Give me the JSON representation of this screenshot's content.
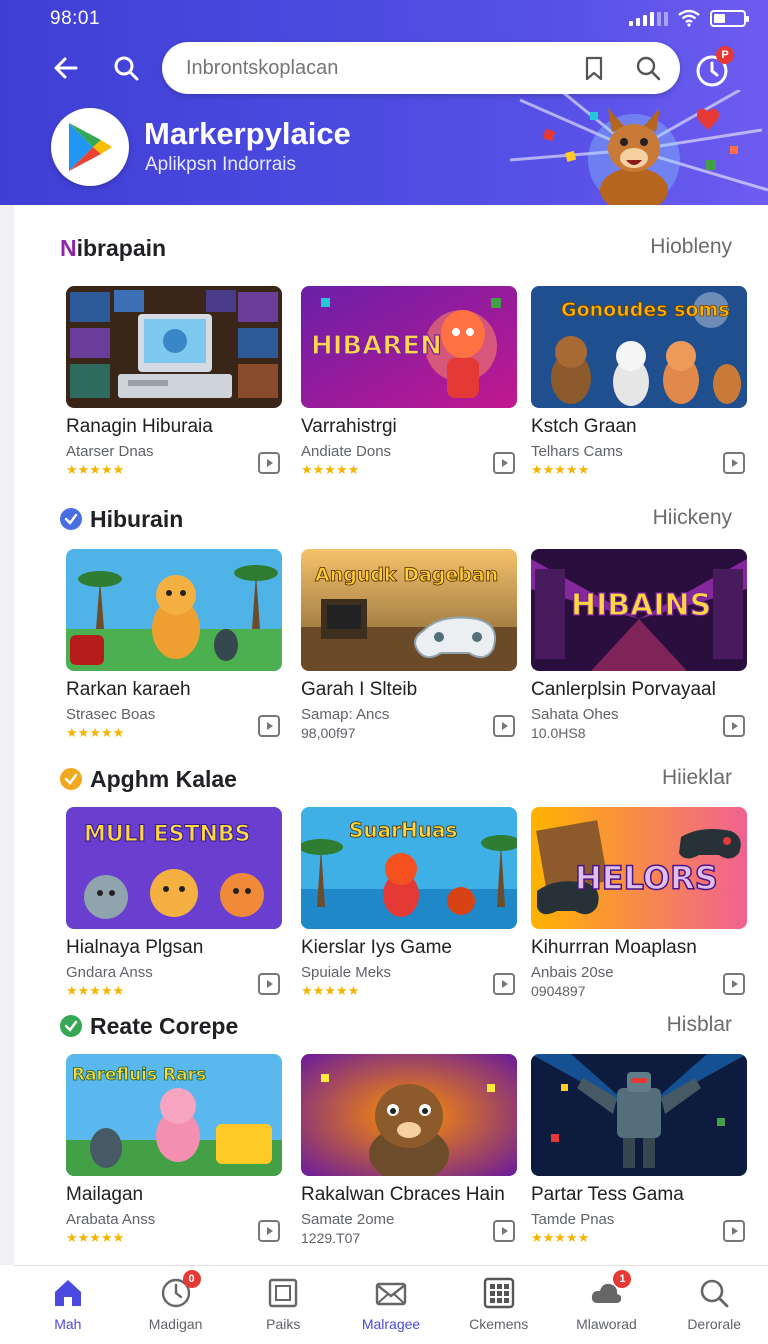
{
  "status_bar": {
    "time": "98:01"
  },
  "header": {
    "search_placeholder": "Inbrontskoplacan",
    "profile_badge": "P",
    "brand_title": "Markerpylaice",
    "brand_subtitle": "Aplikpsn Indorrais"
  },
  "sections": [
    {
      "title": "Nibrapain",
      "more": "Hiobleny",
      "icon": "none",
      "cards": [
        {
          "title": "Ranagin Hiburaia",
          "sub": "Atarser Dnas",
          "stars": "★★★★★"
        },
        {
          "title": "Varrahistrgi",
          "sub": "Andiate Dons",
          "stars": "★★★★★"
        },
        {
          "title": "Kstch Graan",
          "sub": "Telhars Cams",
          "stars": "★★★★★"
        }
      ]
    },
    {
      "title": "Hiburain",
      "more": "Hiickeny",
      "icon": "check-blue",
      "cards": [
        {
          "title": "Rarkan karaeh",
          "sub": "Strasec Boas",
          "stars": "★★★★★"
        },
        {
          "title": "Garah I Slteib",
          "sub": "Samap: Ancs",
          "meta": "98,00f97"
        },
        {
          "title": "Canlerplsin Porvayaal",
          "sub": "Sahata Ohes",
          "meta": "10.0HS8"
        }
      ]
    },
    {
      "title": "Apghm Kalae",
      "more": "Hiieklar",
      "icon": "check-orange",
      "cards": [
        {
          "title": "Hialnaya Plgsan",
          "sub": "Gndara Anss",
          "stars": "★★★★★"
        },
        {
          "title": "Kierslar Iys Game",
          "sub": "Spuiale Meks",
          "stars": "★★★★★"
        },
        {
          "title": "Kihurrran Moaplasn",
          "sub": "Anbais 20se",
          "meta": "0904897"
        }
      ]
    },
    {
      "title": "Reate Corepe",
      "more": "Hisblar",
      "icon": "check-green",
      "cards": [
        {
          "title": "Mailagan",
          "sub": "Arabata Anss",
          "stars": "★★★★★"
        },
        {
          "title": "Rakalwan Cbraces Hain",
          "sub": "Samate 2ome",
          "meta": "1229.T07"
        },
        {
          "title": "Partar Tess Gama",
          "sub": "Tamde Pnas",
          "stars": "★★★★★"
        }
      ]
    }
  ],
  "art_text": {
    "s0c1": "HIBAREN",
    "s0c2": "Gonoudes soms",
    "s1c1": "Angudk Dageban",
    "s1c2": "HIBAINS",
    "s2c0": "MULI ESTNBS",
    "s2c1": "SuarHuas",
    "s2c2": "HELORS",
    "s3c0": "Rarefluis Rars"
  },
  "bottom_nav": [
    {
      "label": "Mah",
      "icon": "home-icon"
    },
    {
      "label": "Madigan",
      "icon": "clock-icon",
      "badge": "0"
    },
    {
      "label": "Paiks",
      "icon": "square-icon"
    },
    {
      "label": "Malragee",
      "icon": "envelope-icon"
    },
    {
      "label": "Ckemens",
      "icon": "grid-icon"
    },
    {
      "label": "Mlaworad",
      "icon": "cloud-icon",
      "badge": "1"
    },
    {
      "label": "Derorale",
      "icon": "search-icon"
    }
  ],
  "colors": {
    "header": "#4545db",
    "accent": "#4a4ae0",
    "star": "#f4b400",
    "badge": "#e53935"
  }
}
